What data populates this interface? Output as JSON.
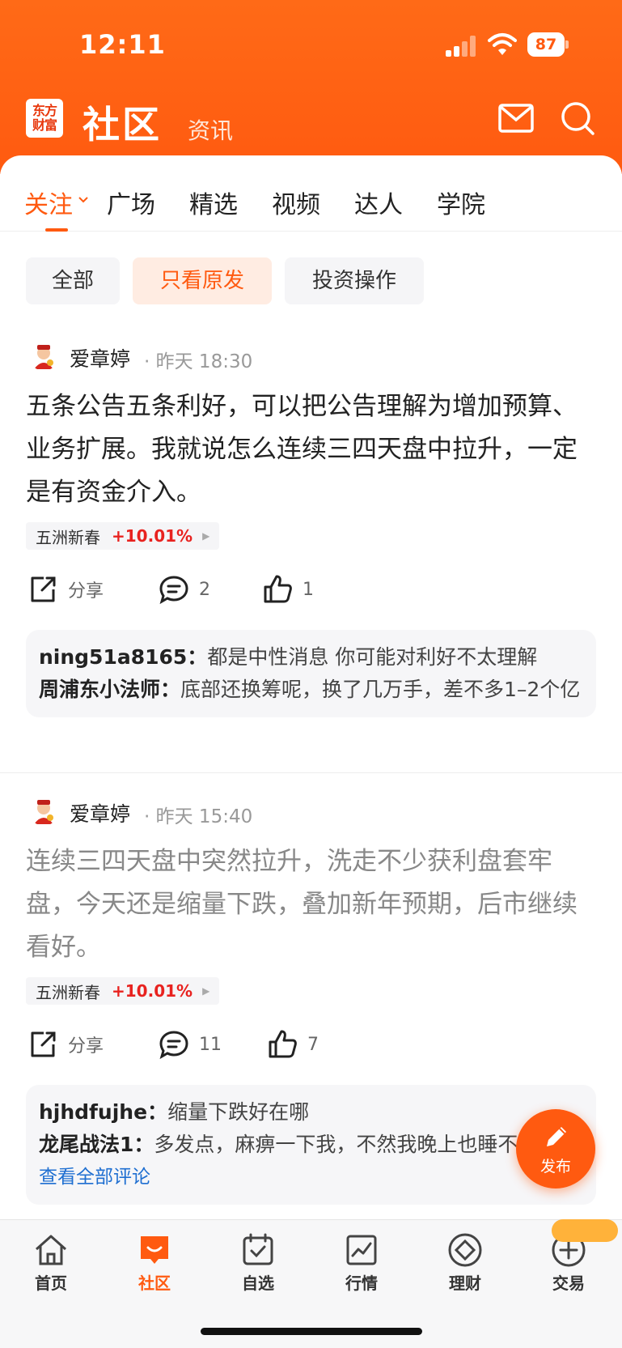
{
  "status_bar": {
    "time": "12:11",
    "battery": "87"
  },
  "header": {
    "logo_line1": "东方",
    "logo_line2": "财富",
    "title": "社区",
    "subtab": "资讯",
    "mail_icon": "mail-icon",
    "search_icon": "search-icon"
  },
  "tabs": [
    {
      "label": "关注",
      "active": true
    },
    {
      "label": "广场"
    },
    {
      "label": "精选"
    },
    {
      "label": "视频"
    },
    {
      "label": "达人"
    },
    {
      "label": "学院"
    }
  ],
  "filters": [
    {
      "label": "全部"
    },
    {
      "label": "只看原发",
      "active": true
    },
    {
      "label": "投资操作"
    }
  ],
  "posts": [
    {
      "author": "爱章婷",
      "meta": "· 昨天 18:30",
      "text": "五条公告五条利好，可以把公告理解为增加预算、业务扩展。我就说怎么连续三四天盘中拉升，一定是有资金介入。",
      "stock": {
        "name": "五洲新春",
        "change": "+10.01%"
      },
      "share_label": "分享",
      "comment_count": "2",
      "like_count": "1",
      "comments": [
        {
          "user": "ning51a8165：",
          "text": "都是中性消息 你可能对利好不太理解"
        },
        {
          "user": "周浦东小法师：",
          "text": "底部还换筹呢，换了几万手，差不多1–2个亿"
        }
      ]
    },
    {
      "author": "爱章婷",
      "meta": "· 昨天 15:40",
      "text": "连续三四天盘中突然拉升，洗走不少获利盘套牢盘，今天还是缩量下跌，叠加新年预期，后市继续看好。",
      "stock": {
        "name": "五洲新春",
        "change": "+10.01%"
      },
      "share_label": "分享",
      "comment_count": "11",
      "like_count": "7",
      "comments": [
        {
          "user": "hjhdfujhe：",
          "text": "缩量下跌好在哪"
        },
        {
          "user": "龙尾战法1：",
          "text": "多发点，麻痹一下我，不然我晚上也睡不着了"
        }
      ],
      "see_all": "查看全部评论"
    }
  ],
  "fab": {
    "label": "发布"
  },
  "bottom_nav": [
    {
      "label": "首页",
      "icon": "home-icon"
    },
    {
      "label": "社区",
      "icon": "community-icon",
      "active": true
    },
    {
      "label": "自选",
      "icon": "watchlist-icon"
    },
    {
      "label": "行情",
      "icon": "market-icon"
    },
    {
      "label": "理财",
      "icon": "wealth-icon"
    },
    {
      "label": "交易",
      "icon": "trade-icon"
    }
  ],
  "colors": {
    "brand": "#ff5a10",
    "up": "#e8221f",
    "link": "#1f6fd1"
  }
}
